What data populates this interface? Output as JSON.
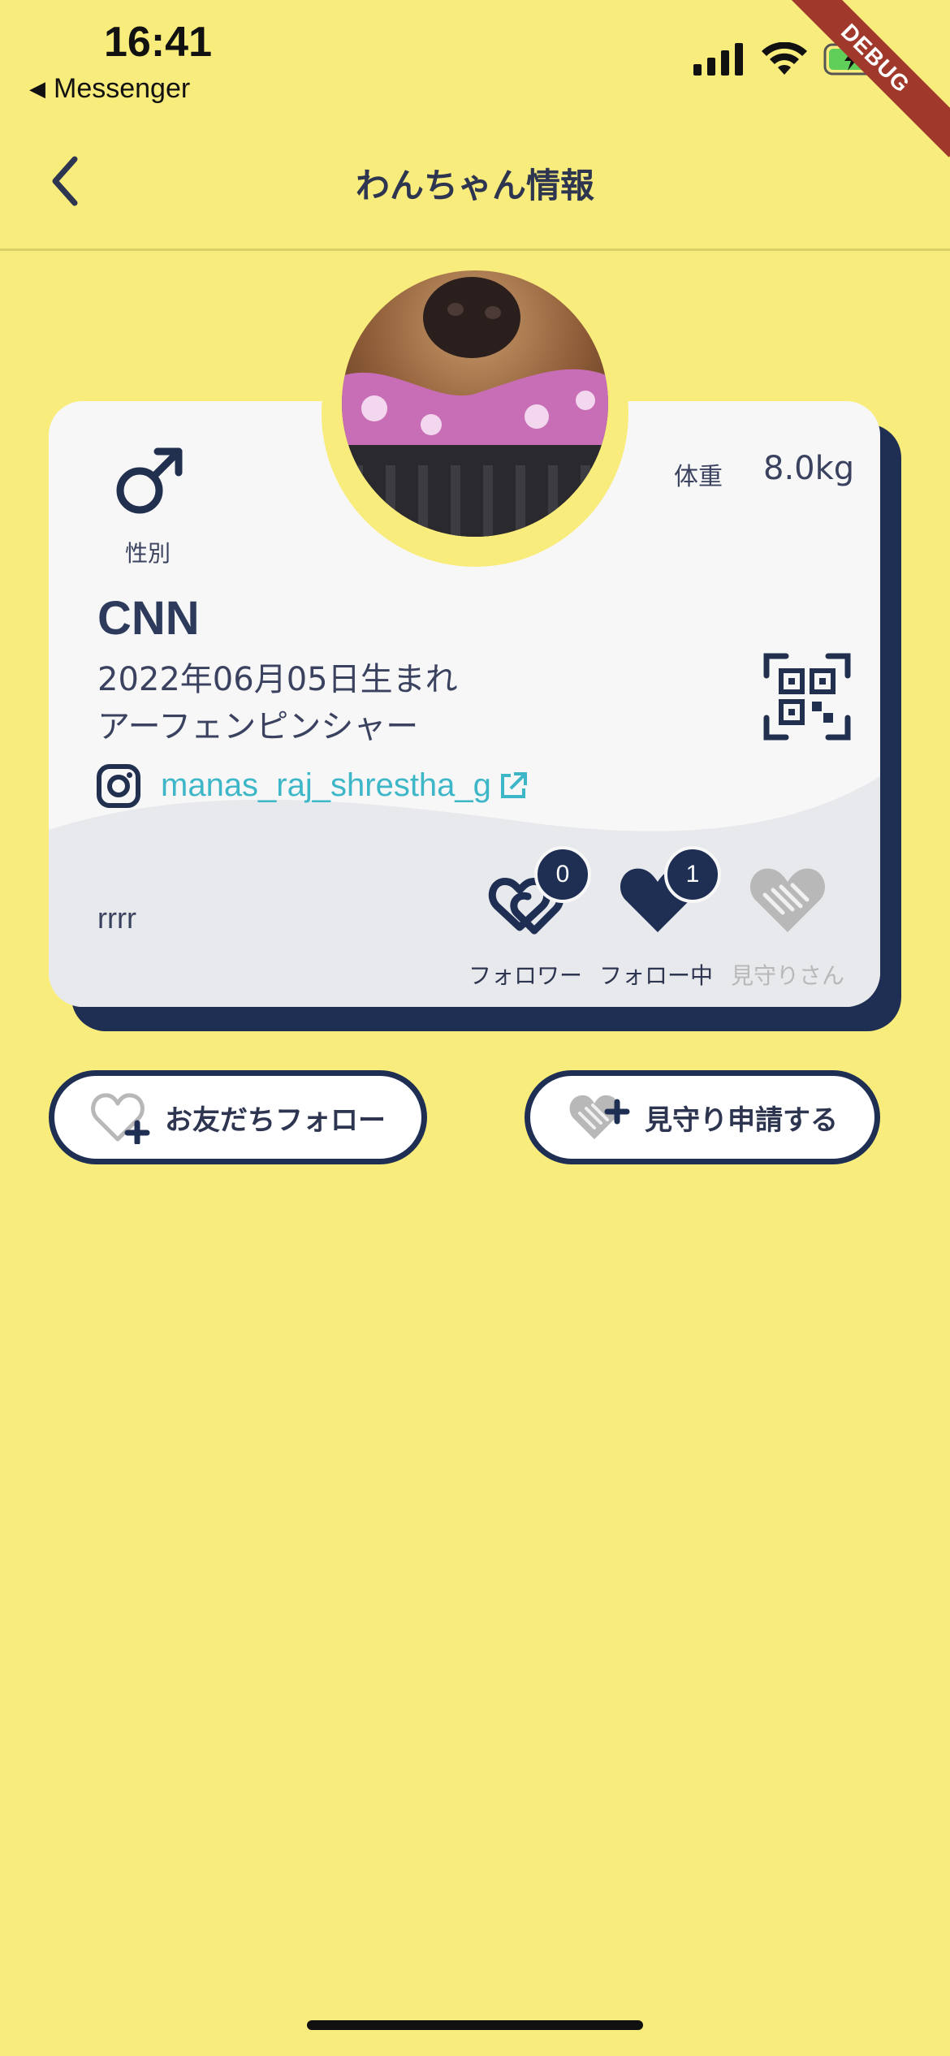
{
  "status_bar": {
    "time": "16:41",
    "back_app": "Messenger",
    "debug_banner": "DEBUG"
  },
  "header": {
    "title": "わんちゃん情報",
    "back_icon": "chevron-left-icon"
  },
  "profile": {
    "gender_label": "性別",
    "gender_icon": "male-icon",
    "weight_label": "体重",
    "weight_value": "8.0kg",
    "name": "CNN",
    "birth": "2022年06月05日生まれ",
    "breed": "アーフェンピンシャー",
    "instagram_handle": "manas_raj_shrestha_g",
    "memo": "rrrr"
  },
  "stats": [
    {
      "label": "フォロワー",
      "count": "0",
      "icon": "hearts-link-icon",
      "color": "#1f2f54"
    },
    {
      "label": "フォロー中",
      "count": "1",
      "icon": "heart-icon",
      "color": "#1f2f54"
    },
    {
      "label": "見守りさん",
      "count": "",
      "icon": "handshake-heart-icon",
      "color": "#b8b8b8"
    }
  ],
  "actions": {
    "follow_label": "お友だちフォロー",
    "watch_label": "見守り申請する"
  },
  "colors": {
    "background": "#f8ec7c",
    "navy": "#1f2f54",
    "card": "#f7f7f7",
    "link": "#3db7c8"
  }
}
